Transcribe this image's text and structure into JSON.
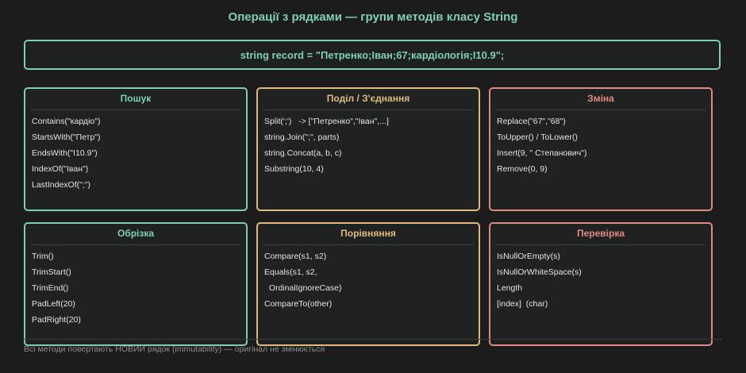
{
  "title": "Операції з рядками — групи методів класу String",
  "record": "string record = \"Петренко;Іван;67;кардіологія;I10.9\";",
  "groups": [
    {
      "title": "Пошук",
      "items": [
        "Contains(\"кардіо\")",
        "StartsWith(\"Петр\")",
        "EndsWith(\"I10.9\")",
        "IndexOf(\"Іван\")",
        "LastIndexOf(\";\")"
      ]
    },
    {
      "title": "Поділ / З'єднання",
      "items": [
        "Split(';')   -> [\"Петренко\",\"Іван\",...]",
        "string.Join(\";\", parts)",
        "string.Concat(a, b, c)",
        "Substring(10, 4)"
      ]
    },
    {
      "title": "Зміна",
      "items": [
        "Replace(\"67\",\"68\")",
        "ToUpper() / ToLower()",
        "Insert(9, \" Степанович\")",
        "Remove(0, 9)"
      ]
    },
    {
      "title": "Обрізка",
      "items": [
        "Trim()",
        "TrimStart()",
        "TrimEnd()",
        "PadLeft(20)",
        "PadRight(20)"
      ]
    },
    {
      "title": "Порівняння",
      "items": [
        "Compare(s1, s2)",
        "Equals(s1, s2,",
        "  OrdinalIgnoreCase)",
        "CompareTo(other)"
      ]
    },
    {
      "title": "Перевірка",
      "items": [
        "IsNullOrEmpty(s)",
        "IsNullOrWhiteSpace(s)",
        "Length",
        "[index]  (char)"
      ]
    }
  ],
  "footer": "Всі методи повертають НОВИЙ рядок (immutability) — оригінал не змінюється",
  "colors": {
    "green": "#7ecfb3",
    "orange": "#e0b97c",
    "red": "#e08a84",
    "background": "#1b1c1b"
  }
}
